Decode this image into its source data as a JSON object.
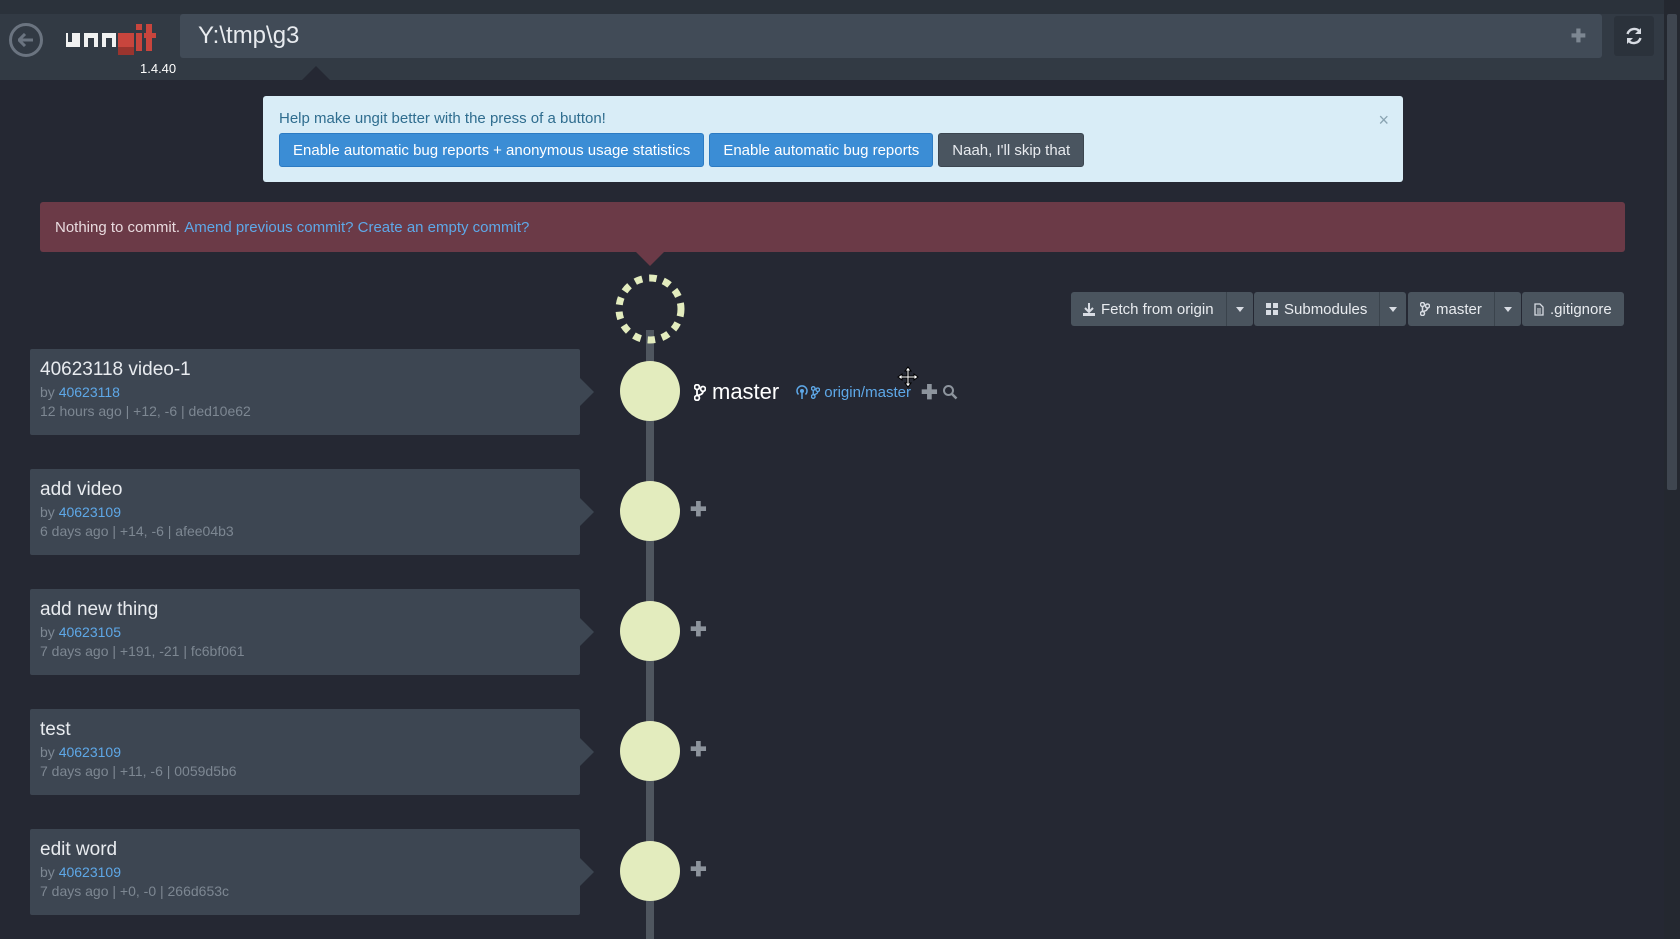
{
  "app": {
    "name": "ungit",
    "version": "1.4.40"
  },
  "header": {
    "path": "Y:\\tmp\\g3",
    "add_icon": "plus-icon",
    "refresh_icon": "refresh-icon",
    "back_icon": "back-icon"
  },
  "banner": {
    "message": "Help make ungit better with the press of a button!",
    "btn_all": "Enable automatic bug reports + anonymous usage statistics",
    "btn_bugs": "Enable automatic bug reports",
    "btn_skip": "Naah, I'll skip that",
    "close": "×"
  },
  "staging": {
    "message": "Nothing to commit.",
    "link_amend": "Amend previous commit?",
    "link_empty": "Create an empty commit?"
  },
  "toolbar": {
    "fetch": "Fetch from origin",
    "submodules": "Submodules",
    "branch": "master",
    "gitignore": ".gitignore"
  },
  "refs": {
    "local": "master",
    "remote": "origin/master"
  },
  "commits": [
    {
      "title": "40623118 video-1",
      "by": "by ",
      "author": "40623118",
      "meta": "12 hours ago | +12, -6 | ded10e62"
    },
    {
      "title": "add video",
      "by": "by ",
      "author": "40623109",
      "meta": "6 days ago | +14, -6 | afee04b3"
    },
    {
      "title": "add new thing",
      "by": "by ",
      "author": "40623105",
      "meta": "7 days ago | +191, -21 | fc6bf061"
    },
    {
      "title": "test",
      "by": "by ",
      "author": "40623109",
      "meta": "7 days ago | +11, -6 | 0059d5b6"
    },
    {
      "title": "edit word",
      "by": "by ",
      "author": "40623109",
      "meta": "7 days ago | +0, -0 | 266d653c"
    }
  ],
  "colors": {
    "background": "#252833",
    "header": "#323a44",
    "node": "#e3ecbe",
    "link": "#5ea8e8",
    "staging_bg": "#6b3a47",
    "banner_bg": "#d9edf7",
    "primary": "#3b8dd5"
  }
}
